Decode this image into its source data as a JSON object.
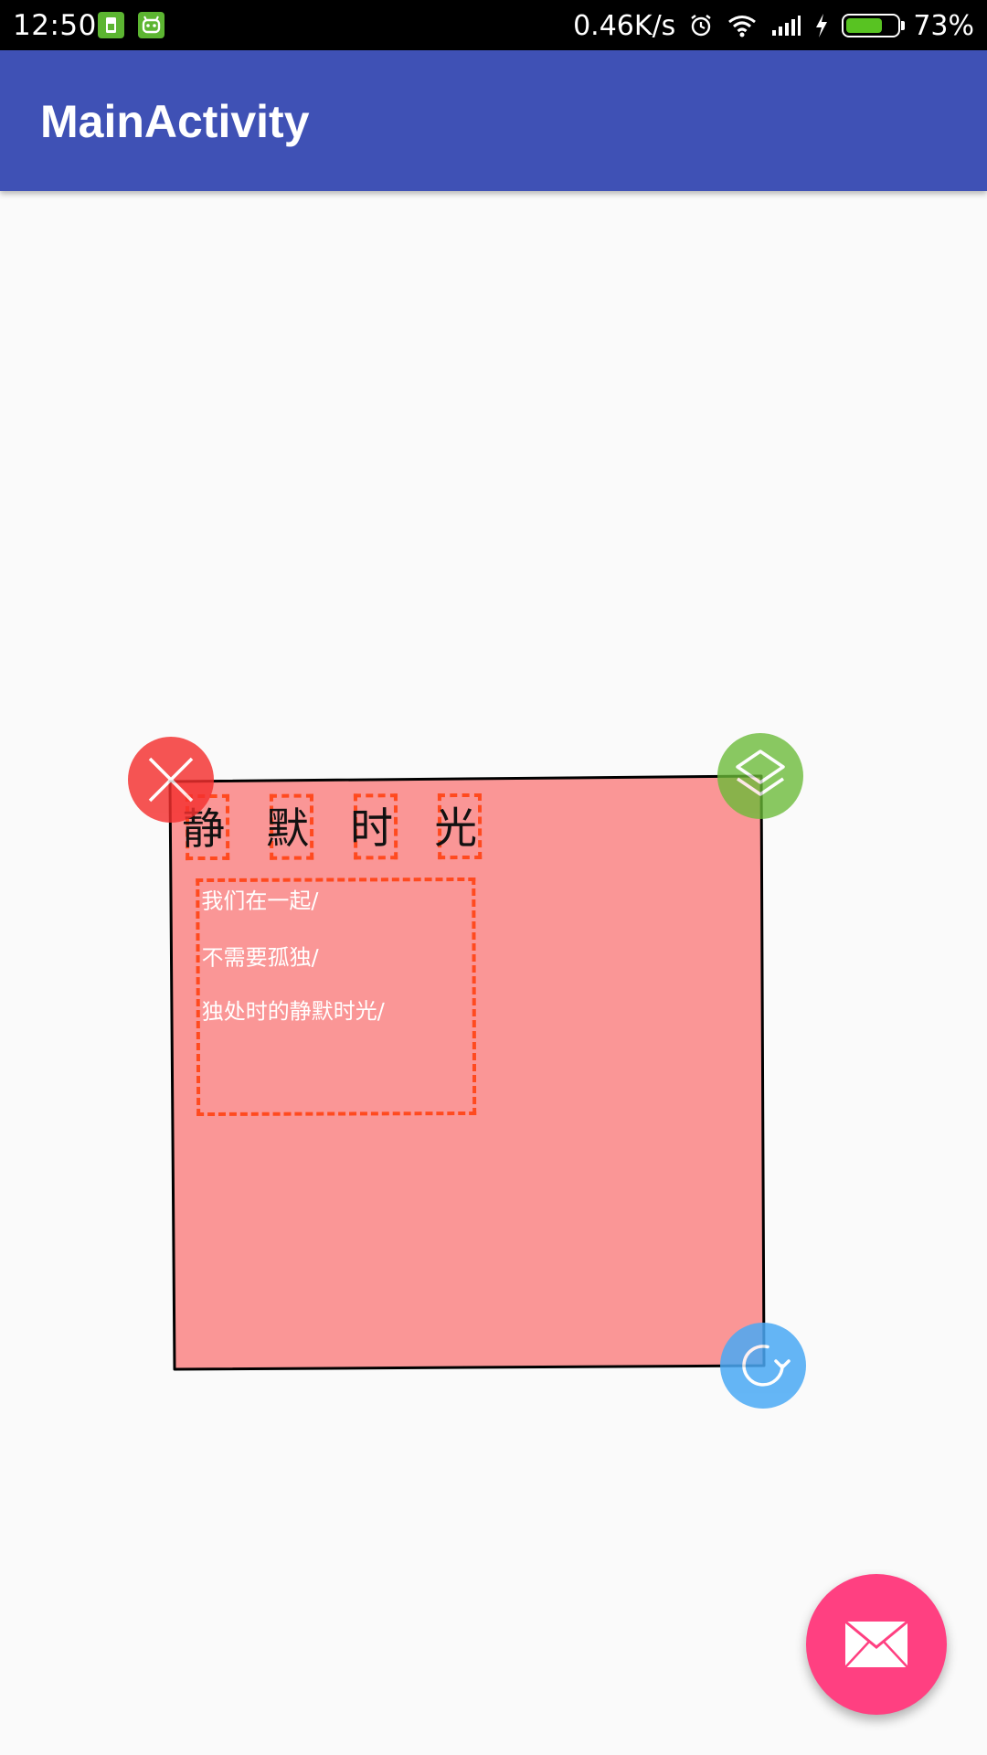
{
  "status_bar": {
    "time": "12:50",
    "network_speed": "0.46K/s",
    "battery_percent": "73%",
    "battery_level": 0.73,
    "icons": [
      "sim-notification-icon",
      "android-notification-icon",
      "alarm-icon",
      "wifi-icon",
      "cellular-signal-icon",
      "charging-icon",
      "battery-icon"
    ]
  },
  "app_bar": {
    "title": "MainActivity",
    "color": "#3f51b5"
  },
  "sticker": {
    "background_color": "#fa9696",
    "outline_color": "#000000",
    "title_chars": [
      "静",
      "默",
      "时",
      "光"
    ],
    "body_lines": [
      "我们在一起/",
      "不需要孤独/",
      "独处时的静默时光/"
    ],
    "handles": {
      "delete_icon": "close-icon",
      "delete_color": "#f5302f",
      "layer_icon": "layers-icon",
      "layer_color": "#6abb37",
      "rotate_icon": "rotate-icon",
      "rotate_color": "#4aa9f5"
    }
  },
  "fab": {
    "icon": "mail-icon",
    "color": "#ff4081"
  }
}
